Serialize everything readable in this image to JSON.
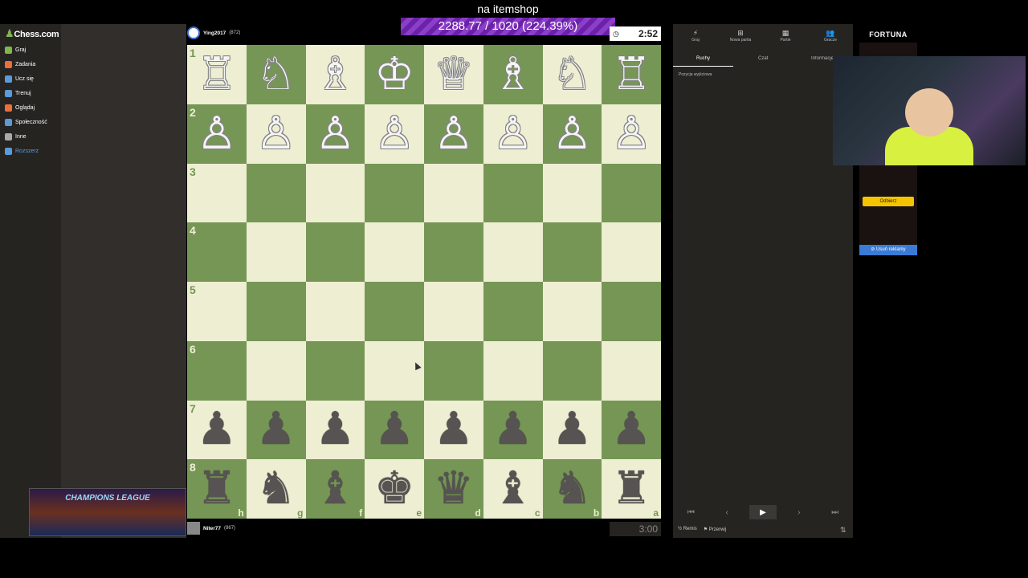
{
  "app": {
    "logo_text": "Chess.com"
  },
  "sidebar": {
    "items": [
      {
        "label": "Graj",
        "color": "#81b64c"
      },
      {
        "label": "Zadania",
        "color": "#e8703a"
      },
      {
        "label": "Ucz się",
        "color": "#5a9bd8"
      },
      {
        "label": "Trenuj",
        "color": "#5a9bd8"
      },
      {
        "label": "Oglądaj",
        "color": "#e8703a"
      },
      {
        "label": "Społeczność",
        "color": "#5a9bd8"
      },
      {
        "label": "Inne",
        "color": "#aaaaaa"
      },
      {
        "label": "Rozszerz",
        "color": "#5a9bd8"
      }
    ]
  },
  "stream_banner": {
    "title": "na itemshop",
    "progress_text": "2288.77 / 1020 (224.39%)"
  },
  "top_player": {
    "name": "Ying2017",
    "rating": "(872)",
    "clock": "2:52"
  },
  "bottom_player": {
    "name": "Niter77",
    "rating": "(867)",
    "clock": "3:00"
  },
  "board": {
    "orientation": "black",
    "rank_labels": [
      "1",
      "2",
      "3",
      "4",
      "5",
      "6",
      "7",
      "8"
    ],
    "file_labels": [
      "h",
      "g",
      "f",
      "e",
      "d",
      "c",
      "b",
      "a"
    ],
    "rows": [
      [
        "♖",
        "♘",
        "♗",
        "♔",
        "♕",
        "♗",
        "♘",
        "♖"
      ],
      [
        "♙",
        "♙",
        "♙",
        "♙",
        "♙",
        "♙",
        "♙",
        "♙"
      ],
      [
        "",
        "",
        "",
        "",
        "",
        "",
        "",
        ""
      ],
      [
        "",
        "",
        "",
        "",
        "",
        "",
        "",
        ""
      ],
      [
        "",
        "",
        "",
        "",
        "",
        "",
        "",
        ""
      ],
      [
        "",
        "",
        "",
        "",
        "",
        "",
        "",
        ""
      ],
      [
        "♟",
        "♟",
        "♟",
        "♟",
        "♟",
        "♟",
        "♟",
        "♟"
      ],
      [
        "♜",
        "♞",
        "♝",
        "♚",
        "♛",
        "♝",
        "♞",
        "♜"
      ]
    ]
  },
  "right_panel": {
    "top_tabs": [
      "Graj",
      "Nowa partia",
      "Partie",
      "Gracze"
    ],
    "tabs": [
      "Ruchy",
      "Czat",
      "Informacje"
    ],
    "start_position": "Pozycja wyjściowa",
    "actions": [
      "Remis",
      "Przerwij"
    ]
  },
  "ad": {
    "brand": "FORTUNA",
    "cta": "Odbierz",
    "remove_label": "Usuń reklamy"
  },
  "thumbnail": {
    "title": "CHAMPIONS LEAGUE"
  }
}
